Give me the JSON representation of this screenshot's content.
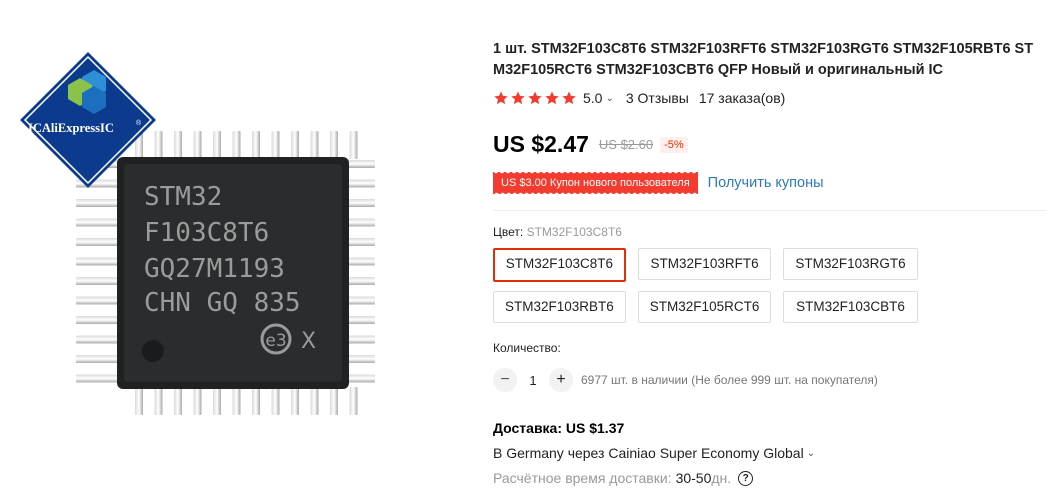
{
  "product": {
    "title": "1 шт. STM32F103C8T6 STM32F103RFT6 STM32F103RGT6 STM32F105RBT6 STM32F105RCT6 STM32F103CBT6 QFP Новый и оригинальный IC",
    "image": {
      "badge_text": "ICAliExpressIC",
      "chip_lines": [
        "STM32",
        "F103C8T6",
        "GQ27M1193",
        "CHN GQ 835"
      ],
      "chip_mark": "e3",
      "chip_mark_suffix": "X"
    }
  },
  "rating": {
    "stars": 5,
    "value": "5.0",
    "reviews": "3 Отзывы",
    "orders": "17 заказа(ов)",
    "star_color": "#f33b2f"
  },
  "price": {
    "current": "US $2.47",
    "old": "US $2.60",
    "discount": "-5%"
  },
  "coupon": {
    "text": "US $3.00 Купон нового пользователя",
    "link": "Получить купоны"
  },
  "color": {
    "label": "Цвет:",
    "selected": "STM32F103C8T6",
    "options": [
      "STM32F103C8T6",
      "STM32F103RFT6",
      "STM32F103RGT6",
      "STM32F103RBT6",
      "STM32F105RCT6",
      "STM32F103CBT6"
    ]
  },
  "quantity": {
    "label": "Количество:",
    "minus": "−",
    "value": "1",
    "plus": "+",
    "stock": "6977 шт. в наличии (Не более 999 шт. на покупателя)"
  },
  "shipping": {
    "title": "Доставка: US $1.37",
    "method": "В Germany через Cainiao Super Economy Global",
    "delivery_label": "Расчётное время доставки:",
    "delivery_days": "30-50",
    "delivery_unit": "дн.",
    "help": "?"
  },
  "colors": {
    "accent": "#e62e04",
    "link": "#2f7ab9",
    "coupon_bg": "#f33b2f"
  }
}
